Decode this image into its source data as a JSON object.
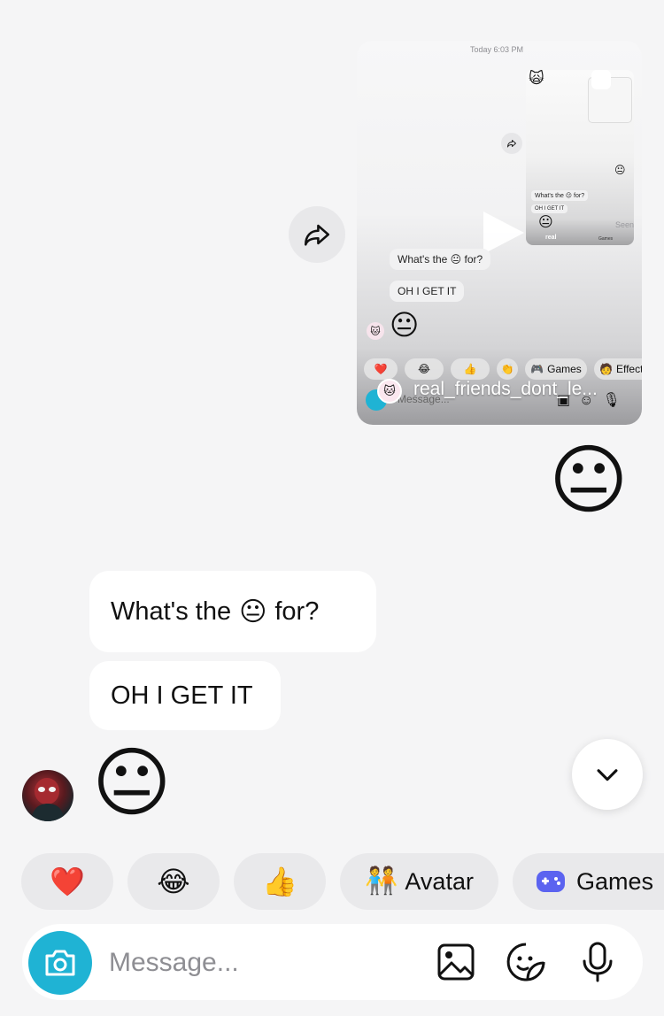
{
  "reel": {
    "timestamp": "Today 6:03 PM",
    "seen": "Seen",
    "username": "real_friends_dont_le...",
    "inner_bubbles": [
      "What's the 😐 for?",
      "OH I GET IT"
    ],
    "inner_emoji": "😐",
    "inner_chips": [
      "❤️",
      "😂",
      "👍",
      "👏"
    ],
    "inner_games": "Games",
    "inner_effects": "Effect",
    "inner_placeholder": "Message...",
    "tiny_top_emoji": "🙀",
    "tiny_emoji": "😐",
    "tiny_bubbles": [
      "What's the 😐 for?",
      "OH I GET IT"
    ],
    "tiny_chip_games": "Games",
    "tiny_username": "real"
  },
  "messages": {
    "sent_emoji": "😐",
    "received": [
      {
        "text_before": "What's the",
        "emoji": "😐",
        "text_after": "for?"
      },
      {
        "text": "OH I GET IT"
      }
    ],
    "received_emoji": "😐"
  },
  "quick_reactions": [
    {
      "icon": "❤️"
    },
    {
      "icon": "😂"
    },
    {
      "icon": "👍"
    },
    {
      "icon": "🧑‍🤝‍🧑",
      "label": "Avatar"
    },
    {
      "icon": "🎮",
      "label": "Games"
    }
  ],
  "composer": {
    "placeholder": "Message..."
  },
  "colors": {
    "background": "#f5f5f6",
    "camera_button": "#1fb3d4",
    "bubble": "#ffffff",
    "chip": "#e9e9eb",
    "games_icon": "#5b63f0"
  }
}
